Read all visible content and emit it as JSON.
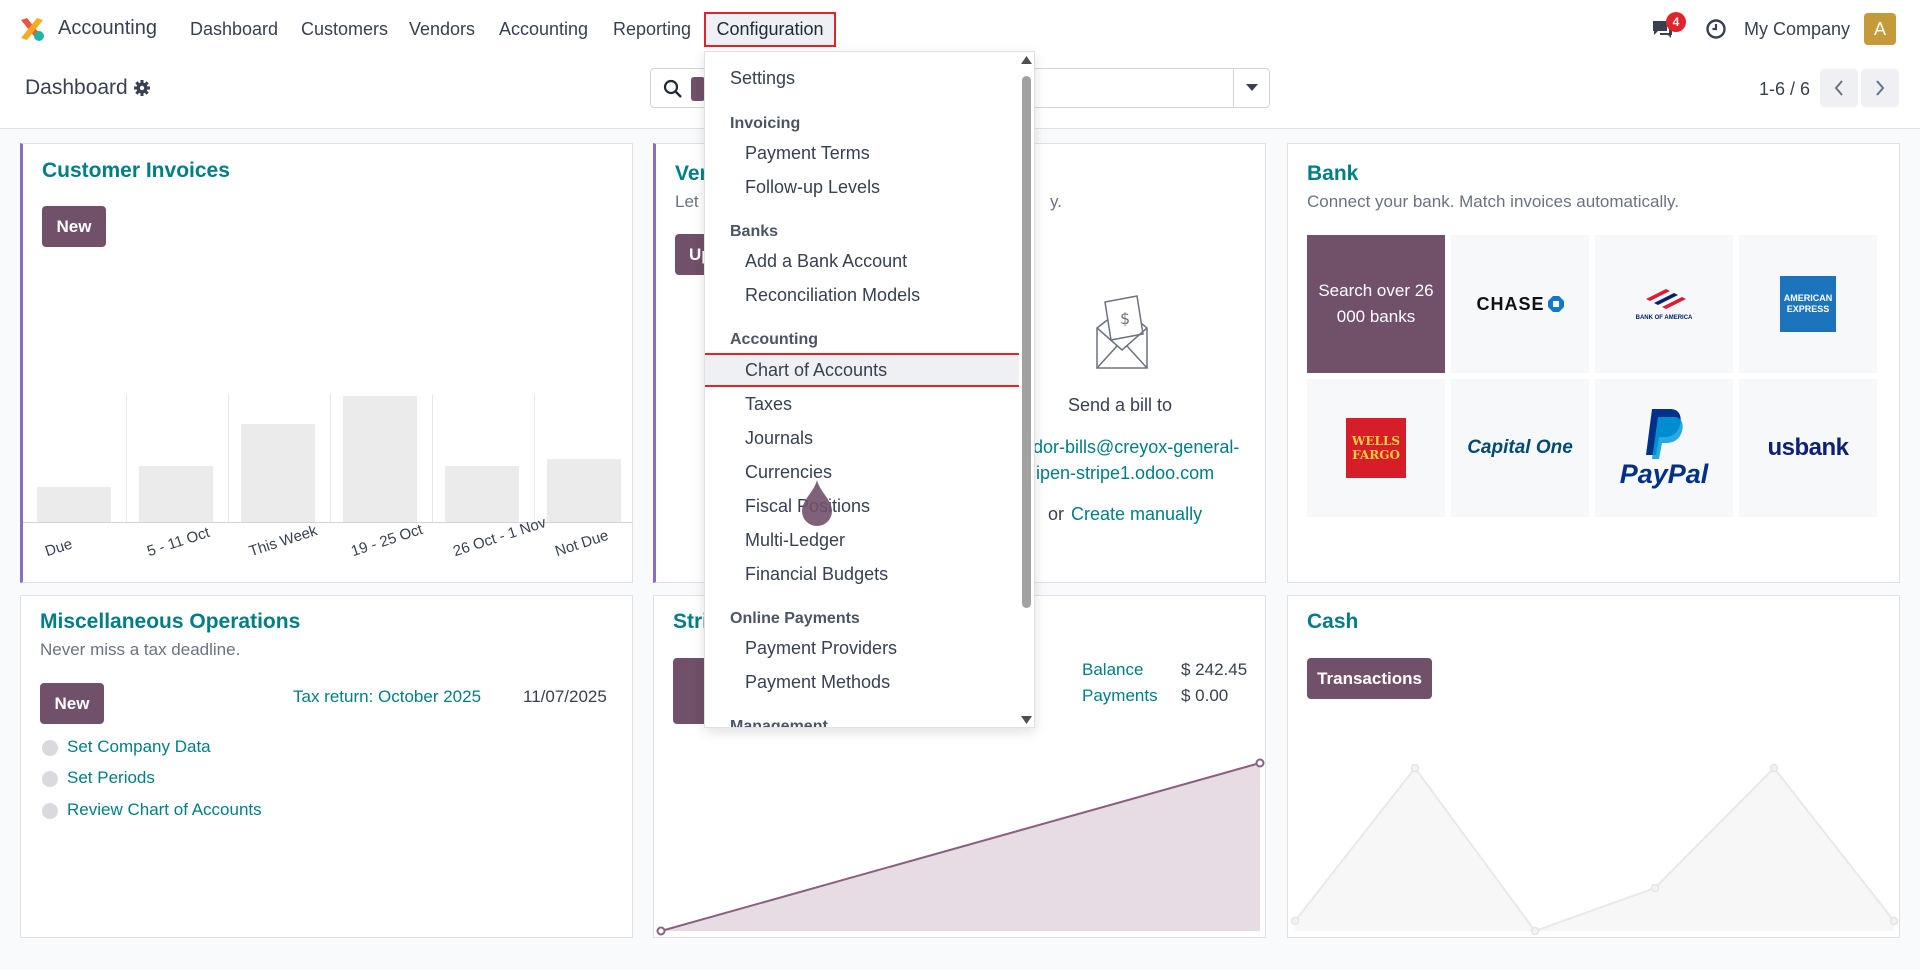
{
  "navbar": {
    "app_name": "Accounting",
    "menu": [
      "Dashboard",
      "Customers",
      "Vendors",
      "Accounting",
      "Reporting"
    ],
    "active_menu": "Configuration",
    "chat_badge": "4",
    "company": "My Company",
    "avatar_letter": "A"
  },
  "control_panel": {
    "title": "Dashboard",
    "pager": "1-6 / 6"
  },
  "cards": {
    "customer_invoices": {
      "title": "Customer Invoices",
      "new_label": "New",
      "chart_data": {
        "type": "bar",
        "categories": [
          "Due",
          "5 - 11 Oct",
          "This Week",
          "19 - 25 Oct",
          "26 Oct - 1 Nov",
          "Not Due"
        ],
        "values": [
          25,
          40,
          70,
          90,
          40,
          45
        ]
      }
    },
    "vendor_bills": {
      "title_fragment": "Ver",
      "sub_fragment": "Let",
      "sub_end": "y.",
      "button_fragment": "Up",
      "send_label": "Send a bill to",
      "email_line1": "dor-bills@creyox-general-",
      "email_line2": "ipen-stripe1.odoo.com",
      "or_label": "or",
      "create_label": "Create manually"
    },
    "bank": {
      "title": "Bank",
      "sub": "Connect your bank. Match invoices automatically.",
      "search_tile": "Search over 26 000 banks",
      "banks": [
        "CHASE",
        "BANK OF AMERICA",
        "AMERICAN EXPRESS",
        "WELLS FARGO",
        "Capital One",
        "PayPal",
        "usbank"
      ]
    },
    "misc": {
      "title": "Miscellaneous Operations",
      "sub": "Never miss a tax deadline.",
      "new_label": "New",
      "tax_link": "Tax return: October 2025",
      "tax_date": "11/07/2025",
      "todos": [
        "Set Company Data",
        "Set Periods",
        "Review Chart of Accounts"
      ]
    },
    "stripe": {
      "title_fragment": "Stri",
      "balance_label": "Balance",
      "balance_value": "$ 242.45",
      "payments_label": "Payments",
      "payments_value": "$ 0.00"
    },
    "cash": {
      "title": "Cash",
      "transactions_label": "Transactions"
    }
  },
  "dropdown": {
    "settings": "Settings",
    "invoicing_header": "Invoicing",
    "payment_terms": "Payment Terms",
    "followup": "Follow-up Levels",
    "banks_header": "Banks",
    "add_bank": "Add a Bank Account",
    "reconciliation": "Reconciliation Models",
    "accounting_header": "Accounting",
    "chart_of_accounts": "Chart of Accounts",
    "taxes": "Taxes",
    "journals": "Journals",
    "currencies": "Currencies",
    "fiscal_positions": "Fiscal Positions",
    "multi_ledger": "Multi-Ledger",
    "financial_budgets": "Financial Budgets",
    "online_payments_header": "Online Payments",
    "payment_providers": "Payment Providers",
    "payment_methods": "Payment Methods",
    "management_header": "Management"
  }
}
